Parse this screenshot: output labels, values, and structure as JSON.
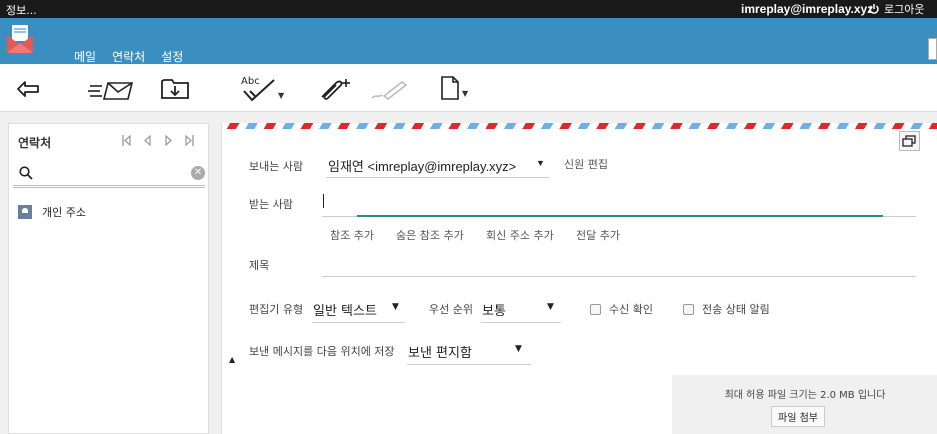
{
  "window": {
    "title": "정보..."
  },
  "user": {
    "email": "imreplay@imreplay.xyz",
    "logout_label": "로그아웃"
  },
  "nav": {
    "tabs": [
      {
        "label": "메일",
        "active": true
      },
      {
        "label": "연락처"
      },
      {
        "label": "설정"
      }
    ]
  },
  "toolbar": {
    "icons": [
      "back-icon",
      "send-icon",
      "save-draft-icon",
      "spellcheck-icon",
      "attach-icon",
      "signature-icon",
      "file-icon"
    ],
    "spellcheck_text": "Abc"
  },
  "contacts": {
    "title": "연락처",
    "search_placeholder": "",
    "items": [
      {
        "label": "개인 주소"
      }
    ]
  },
  "compose": {
    "from_label": "보내는 사람",
    "from_value": "임재연 <imreplay@imreplay.xyz>",
    "edit_identity_link": "신원 편집",
    "to_label": "받는 사람",
    "add_links": [
      "참조 추가",
      "숨은 참조 추가",
      "회신 주소 추가",
      "전달 추가"
    ],
    "subject_label": "제목",
    "editor_type_label": "편집기 유형",
    "editor_type_value": "일반 텍스트",
    "priority_label": "우선 순위",
    "priority_value": "보통",
    "receipt_label": "수신 확인",
    "delivery_status_label": "전송 상태 알림",
    "save_sent_label": "보낸 메시지를 다음 위치에 저장",
    "save_sent_value": "보낸 편지함"
  },
  "attachment": {
    "max_size_text": "최대 허용 파일 크기는 2.0 MB 입니다",
    "button_label": "파일 첨부"
  },
  "colors": {
    "header": "#3a8fc0",
    "active_tab_underline": "#6ec06e",
    "focus_line": "#2a8b8b"
  }
}
